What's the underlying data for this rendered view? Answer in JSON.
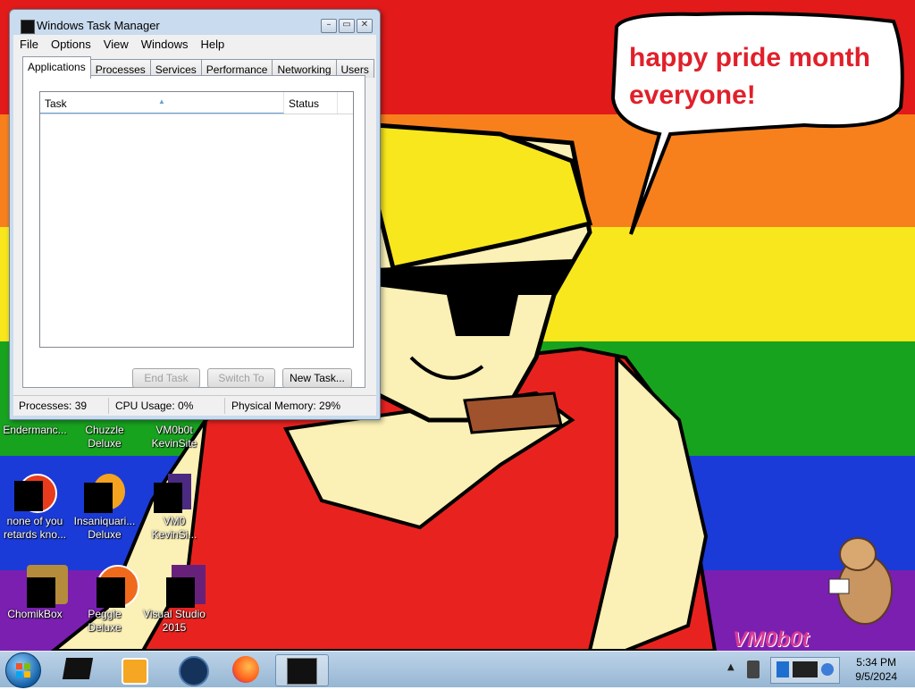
{
  "wallpaper": {
    "stripes": [
      "#e21a1a",
      "#f7801c",
      "#f8e71c",
      "#18a31f",
      "#1a3bd8",
      "#7a1fb0"
    ],
    "speech_bubble": "happy pride month everyone!",
    "signature": "VM0b0t"
  },
  "desktop_icons": [
    {
      "label": "Endermanc..."
    },
    {
      "label": "Chuzzle Deluxe"
    },
    {
      "label": "VM0b0t KevinSite"
    },
    {
      "label": "none of you retards kno..."
    },
    {
      "label": "Insaniquari... Deluxe"
    },
    {
      "label": "VM0 KevinSi..."
    },
    {
      "label": "ChomikBox"
    },
    {
      "label": "Peggle Deluxe"
    },
    {
      "label": "Visual Studio 2015"
    }
  ],
  "task_manager": {
    "title": "Windows Task Manager",
    "menu": [
      "File",
      "Options",
      "View",
      "Windows",
      "Help"
    ],
    "tabs": [
      "Applications",
      "Processes",
      "Services",
      "Performance",
      "Networking",
      "Users"
    ],
    "columns": {
      "task": "Task",
      "status": "Status"
    },
    "buttons": {
      "end_task": "End Task",
      "switch_to": "Switch To",
      "new_task": "New Task..."
    },
    "status": {
      "processes": "Processes: 39",
      "cpu": "CPU Usage: 0%",
      "memory": "Physical Memory: 29%"
    }
  },
  "taskbar": {
    "time": "5:34 PM",
    "date": "9/5/2024"
  }
}
